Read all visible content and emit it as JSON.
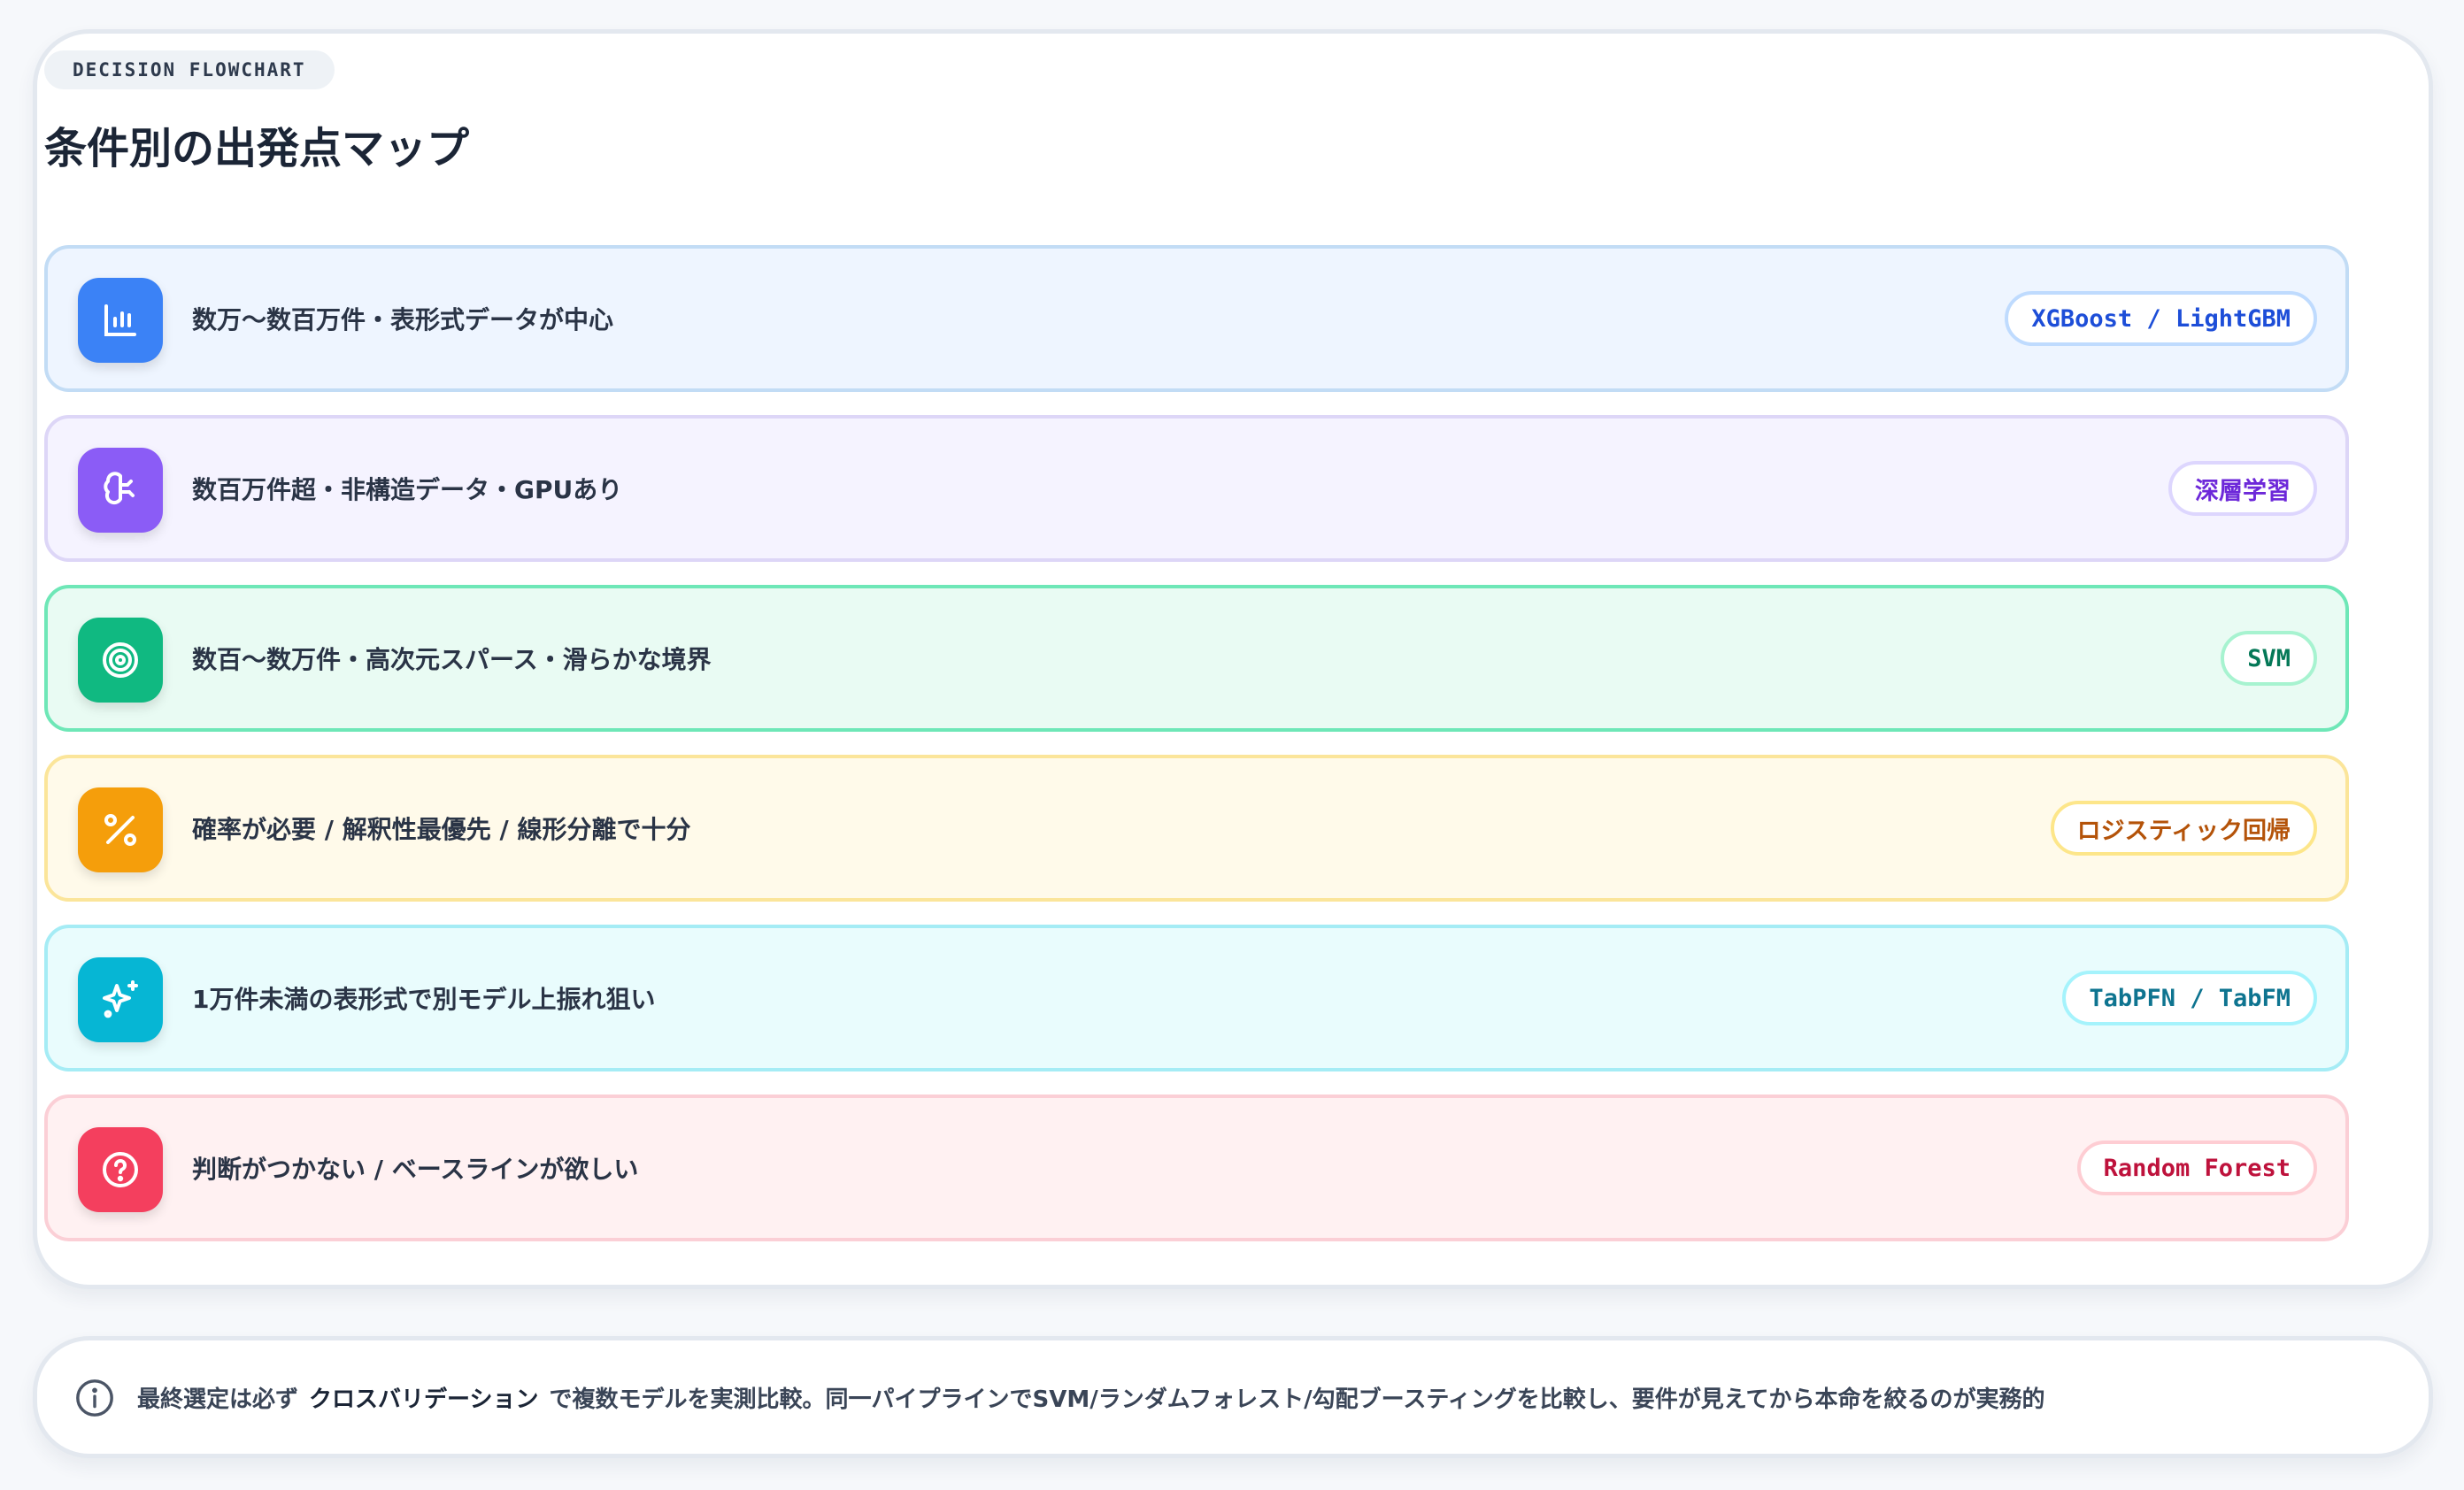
{
  "header": {
    "eyebrow": "DECISION FLOWCHART",
    "title": "条件別の出発点マップ"
  },
  "rows": [
    {
      "condition": "数万〜数百万件・表形式データが中心",
      "recommendation": "XGBoost / LightGBM",
      "icon": "bar-chart-icon",
      "color": "#3b82f6"
    },
    {
      "condition": "数百万件超・非構造データ・GPUあり",
      "recommendation": "深層学習",
      "icon": "brain-icon",
      "color": "#8b5cf6"
    },
    {
      "condition": "数百〜数万件・高次元スパース・滑らかな境界",
      "recommendation": "SVM",
      "icon": "target-icon",
      "color": "#10b981"
    },
    {
      "condition": "確率が必要 / 解釈性最優先 / 線形分離で十分",
      "recommendation": "ロジスティック回帰",
      "icon": "percent-icon",
      "color": "#f59e0b"
    },
    {
      "condition": "1万件未満の表形式で別モデル上振れ狙い",
      "recommendation": "TabPFN / TabFM",
      "icon": "sparkles-icon",
      "color": "#06b6d4"
    },
    {
      "condition": "判断がつかない / ベースラインが欲しい",
      "recommendation": "Random Forest",
      "icon": "question-icon",
      "color": "#f43f5e"
    }
  ],
  "note": {
    "icon": "info-icon",
    "prefix": "最終選定は必ず",
    "emphasis": "クロスバリデーション",
    "suffix": "で複数モデルを実測比較。同一パイプラインでSVM/ランダムフォレスト/勾配ブースティングを比較し、要件が見えてから本命を絞るのが実務的"
  }
}
